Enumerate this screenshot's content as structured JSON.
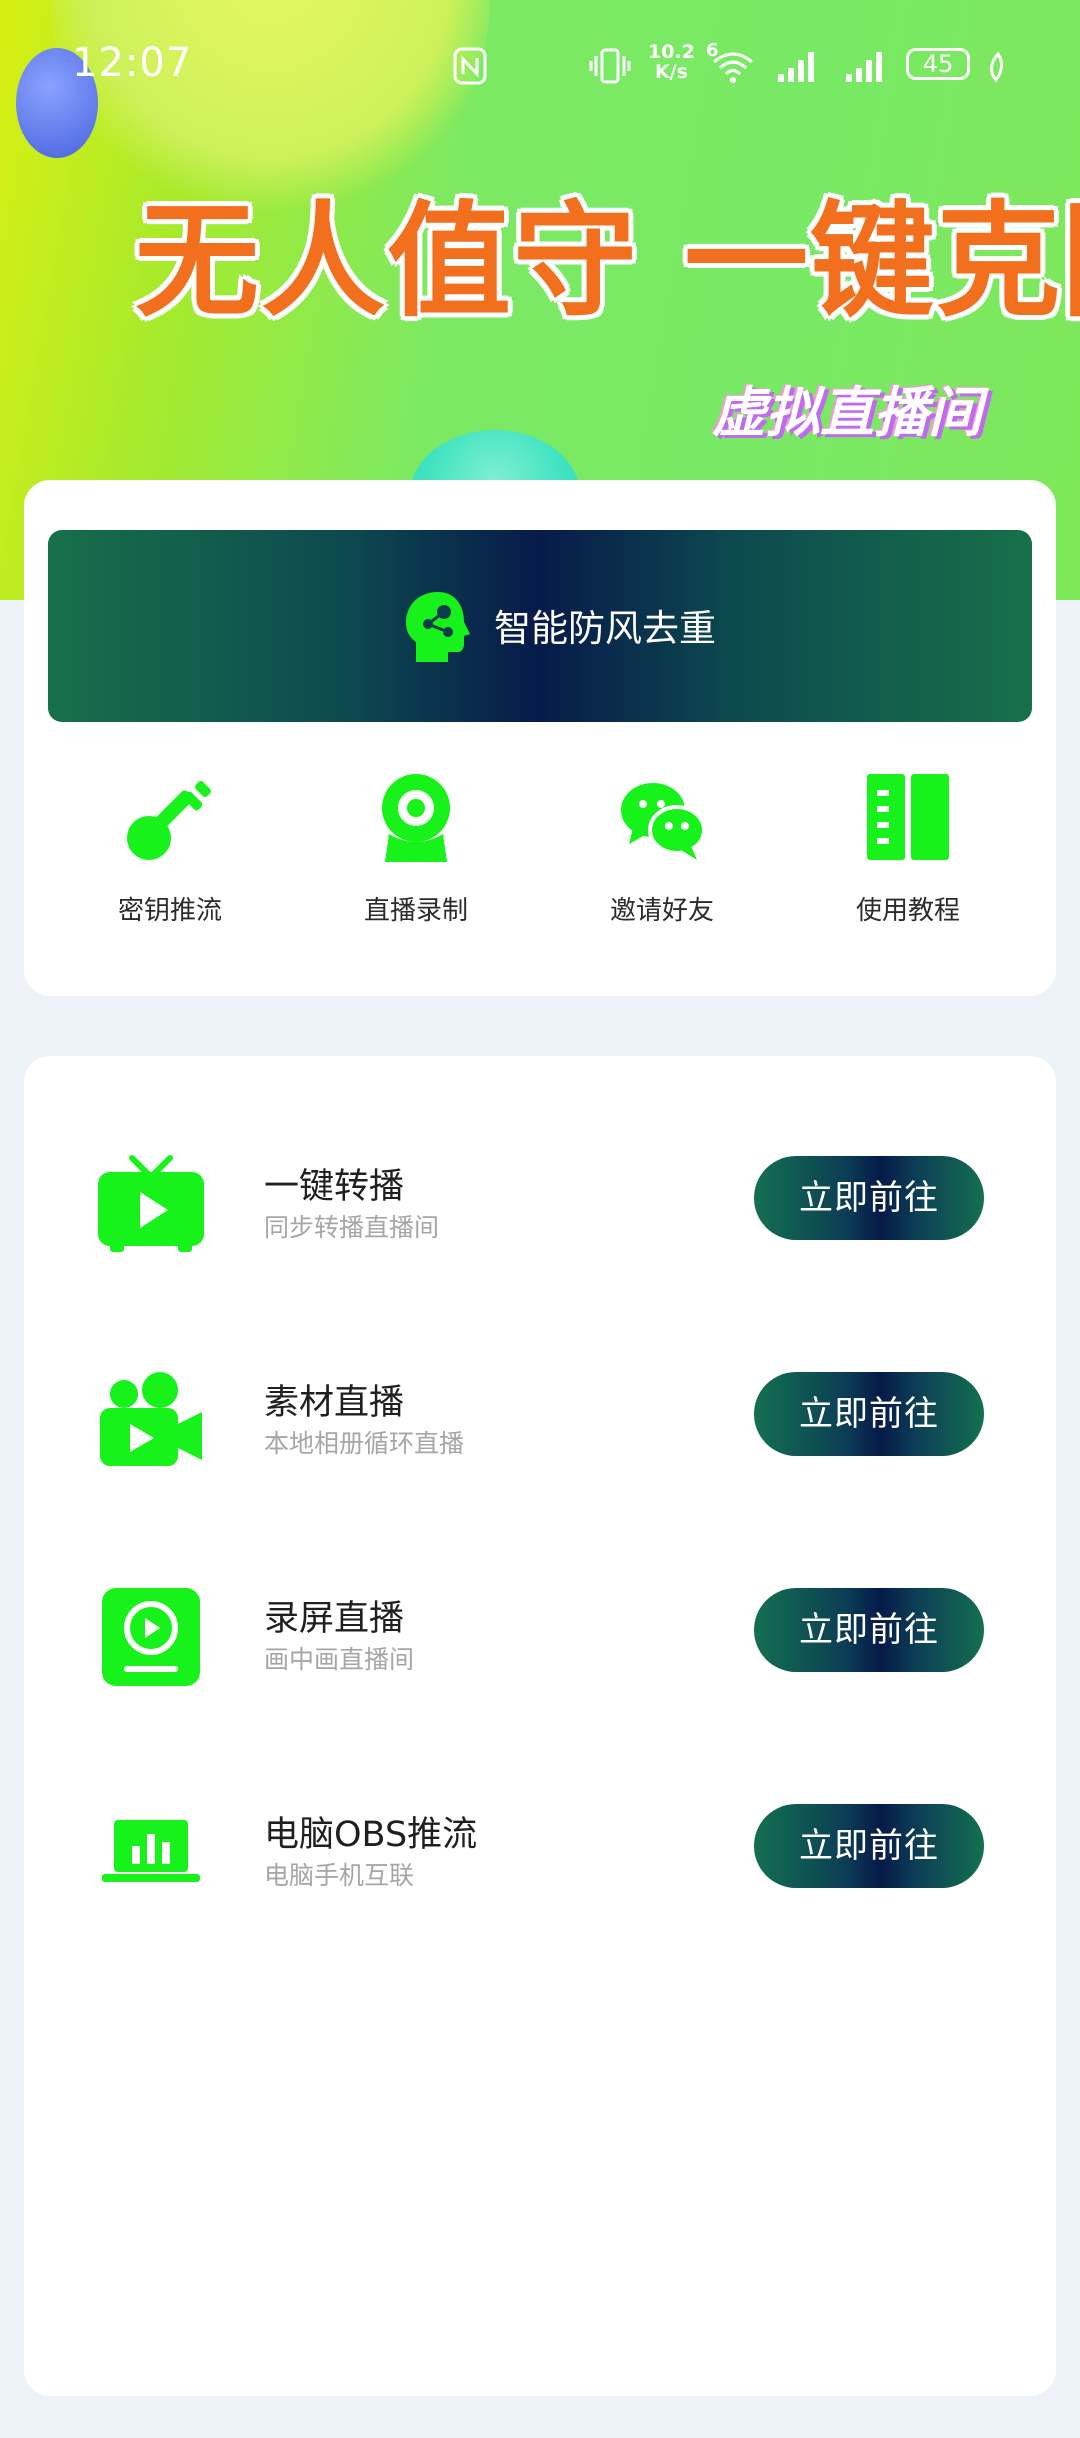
{
  "status_bar": {
    "time": "12:07",
    "net_speed_value": "10.2",
    "net_speed_unit": "K/s",
    "network_type": "6",
    "battery": "45"
  },
  "banner": {
    "title": "无人值守 一键克隆",
    "subtitle": "虚拟直播间"
  },
  "promo": {
    "label": "智能防风去重",
    "icon": "ai-head-icon"
  },
  "quick_actions": [
    {
      "label": "密钥推流",
      "icon": "key-icon"
    },
    {
      "label": "直播录制",
      "icon": "webcam-icon"
    },
    {
      "label": "邀请好友",
      "icon": "wechat-icon"
    },
    {
      "label": "使用教程",
      "icon": "book-icon"
    }
  ],
  "features": [
    {
      "title": "一键转播",
      "subtitle": "同步转播直播间",
      "button": "立即前往",
      "icon": "tv-play-icon"
    },
    {
      "title": "素材直播",
      "subtitle": "本地相册循环直播",
      "button": "立即前往",
      "icon": "video-camera-icon"
    },
    {
      "title": "录屏直播",
      "subtitle": "画中画直播间",
      "button": "立即前往",
      "icon": "screen-record-icon"
    },
    {
      "title": "电脑OBS推流",
      "subtitle": "电脑手机互联",
      "button": "立即前往",
      "icon": "laptop-chart-icon"
    }
  ],
  "colors": {
    "icon_green": "#16f21a",
    "accent_orange": "#f2701d",
    "button_dark": "#061a48",
    "button_edge": "#147050"
  }
}
